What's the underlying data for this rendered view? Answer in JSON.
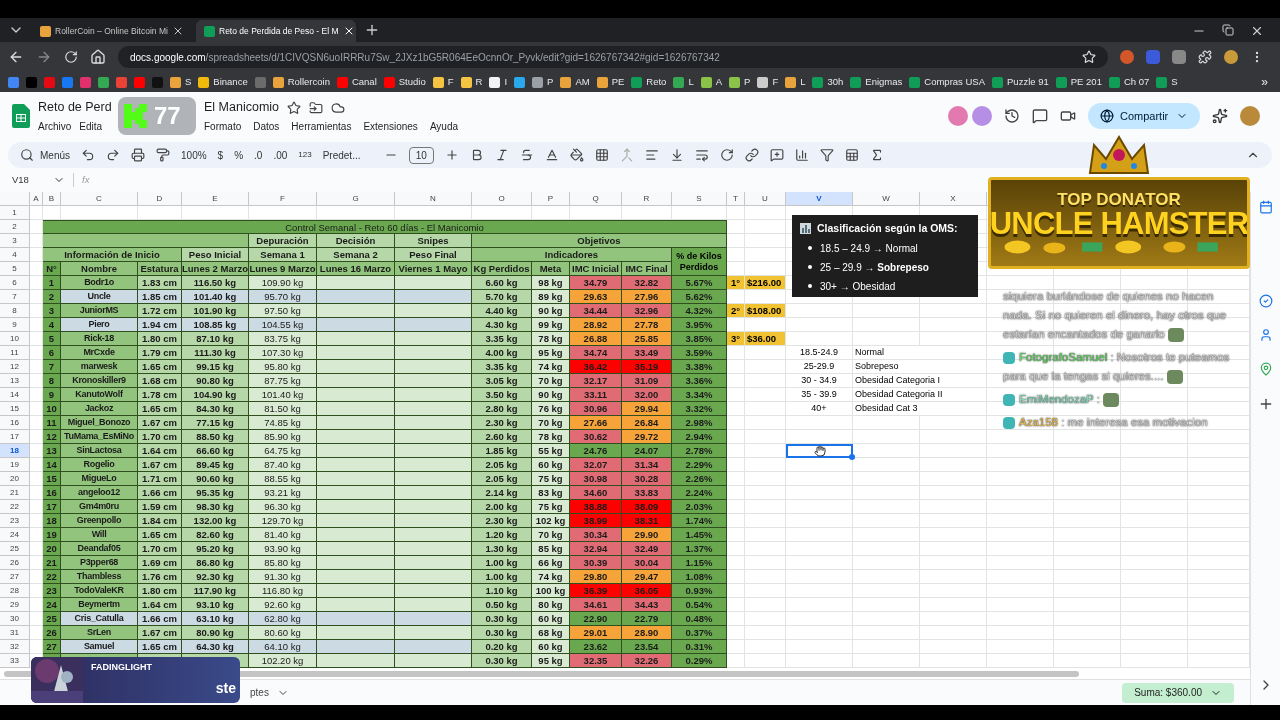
{
  "browser": {
    "tabs": [
      {
        "title": "RollerCoin – Online Bitcoin Mi",
        "selected": false
      },
      {
        "title": "Reto de Perdida de Peso - El M",
        "selected": true
      }
    ],
    "url": {
      "domain": "docs.google.com",
      "path": "/spreadsheets/d/1CIVQSN6uoIRRRu7Sw_2JXz1bG5R064EeOcnnOr_Pyvk/edit?gid=1626767342#gid=1626767342"
    },
    "bookmarks": [
      {
        "color": "#4285f4"
      },
      {
        "color": "#000000"
      },
      {
        "color": "#e50914"
      },
      {
        "color": "#1877f2"
      },
      {
        "color": "#e1306c"
      },
      {
        "color": "#34a853"
      },
      {
        "color": "#ea4335"
      },
      {
        "color": "#ff0000"
      },
      {
        "color": "#111111"
      },
      {
        "label": "S",
        "color": "#e8a33d"
      },
      {
        "label": "Binance",
        "color": "#f0b90b"
      },
      {
        "color": "#6b6b6b"
      },
      {
        "label": "Rollercoin",
        "color": "#e8a33d"
      },
      {
        "label": "Canal",
        "color": "#ff0000"
      },
      {
        "label": "Studio",
        "color": "#ff0000"
      },
      {
        "label": "F",
        "color": "#f5c542"
      },
      {
        "label": "R",
        "color": "#f5c542"
      },
      {
        "label": "I",
        "color": "#f1f3f4"
      },
      {
        "color": "#29a9eb"
      },
      {
        "label": "P",
        "color": "#9aa0a6"
      },
      {
        "label": "AM",
        "color": "#e8a33d"
      },
      {
        "label": "PE",
        "color": "#e8a33d"
      },
      {
        "label": "Reto",
        "color": "#0f9d58"
      },
      {
        "label": "L",
        "color": "#34a853"
      },
      {
        "label": "A",
        "color": "#8bc34a"
      },
      {
        "label": "P",
        "color": "#8bc34a"
      },
      {
        "label": "F",
        "color": "#cccccc"
      },
      {
        "label": "L",
        "color": "#e8a33d"
      },
      {
        "label": "30h",
        "color": "#0f9d58"
      },
      {
        "label": "Enigmas",
        "color": "#0f9d58"
      },
      {
        "label": "Compras USA",
        "color": "#0f9d58"
      },
      {
        "label": "Puzzle 91",
        "color": "#0f9d58"
      },
      {
        "label": "PE 201",
        "color": "#0f9d58"
      },
      {
        "label": "Ch 07",
        "color": "#0f9d58"
      },
      {
        "label": "S",
        "color": "#0f9d58"
      }
    ],
    "bookmarks_more": "»"
  },
  "doc": {
    "title_start": "Reto de Perd",
    "title_end": "El Manicomio",
    "menus_start": [
      "Archivo",
      "Edita"
    ],
    "menus_end": [
      "Formato",
      "Datos",
      "Herramientas",
      "Extensiones",
      "Ayuda"
    ],
    "share": "Compartir"
  },
  "stream_badge": {
    "count": "77"
  },
  "toolbar": {
    "menus": "Menús",
    "zoom": "100%",
    "currency": "$",
    "percent": "%",
    "dec_less": ".0",
    "dec_more": ".00",
    "number_format": "123",
    "font": "Predet...",
    "font_size": "10"
  },
  "formula_bar": {
    "cell": "V18",
    "fx": "fx"
  },
  "column_headers": [
    {
      "label": "A",
      "selected": false
    },
    {
      "label": "B",
      "selected": false
    },
    {
      "label": "C",
      "selected": false
    },
    {
      "label": "D",
      "selected": false
    },
    {
      "label": "E",
      "selected": false
    },
    {
      "label": "F",
      "selected": false
    },
    {
      "label": "G",
      "selected": false
    },
    {
      "label": "N",
      "selected": false
    },
    {
      "label": "O",
      "selected": false
    },
    {
      "label": "P",
      "selected": false
    },
    {
      "label": "Q",
      "selected": false
    },
    {
      "label": "R",
      "selected": false
    },
    {
      "label": "S",
      "selected": false
    },
    {
      "label": "T",
      "selected": false
    },
    {
      "label": "U",
      "selected": false
    },
    {
      "label": "V",
      "selected": true
    },
    {
      "label": "W",
      "selected": false
    },
    {
      "label": "X",
      "selected": false
    }
  ],
  "row_numbers": [
    {
      "label": "1",
      "selected": false
    },
    {
      "label": "2",
      "selected": false
    },
    {
      "label": "3",
      "selected": false
    },
    {
      "label": "4",
      "selected": false
    },
    {
      "label": "5",
      "selected": false
    },
    {
      "label": "6",
      "selected": false
    },
    {
      "label": "7",
      "selected": false
    },
    {
      "label": "8",
      "selected": false
    },
    {
      "label": "9",
      "selected": false
    },
    {
      "label": "10",
      "selected": false
    },
    {
      "label": "11",
      "selected": false
    },
    {
      "label": "12",
      "selected": false
    },
    {
      "label": "13",
      "selected": false
    },
    {
      "label": "14",
      "selected": false
    },
    {
      "label": "15",
      "selected": false
    },
    {
      "label": "16",
      "selected": false
    },
    {
      "label": "17",
      "selected": false
    },
    {
      "label": "18",
      "selected": true
    },
    {
      "label": "19",
      "selected": false
    },
    {
      "label": "20",
      "selected": false
    },
    {
      "label": "21",
      "selected": false
    },
    {
      "label": "22",
      "selected": false
    },
    {
      "label": "23",
      "selected": false
    },
    {
      "label": "24",
      "selected": false
    },
    {
      "label": "25",
      "selected": false
    },
    {
      "label": "26",
      "selected": false
    },
    {
      "label": "27",
      "selected": false
    },
    {
      "label": "28",
      "selected": false
    },
    {
      "label": "29",
      "selected": false
    },
    {
      "label": "30",
      "selected": false
    },
    {
      "label": "31",
      "selected": false
    },
    {
      "label": "32",
      "selected": false
    },
    {
      "label": "33",
      "selected": false
    }
  ],
  "sheet_table": {
    "title": "Control Semanal - Reto 60 días - El Manicomio",
    "group_row": {
      "depuracion": "Depuración",
      "decision": "Decisión",
      "snipes": "Snipes",
      "objetivos": "Objetivos"
    },
    "section_row": {
      "info": "Información de Inicio",
      "peso_inicial": "Peso Inicial",
      "semana1": "Semana 1",
      "semana2": "Semana 2",
      "peso_final": "Peso Final",
      "indicadores": "Indicadores",
      "pct": "% de Kilos Perdidos"
    },
    "columns": [
      "N°",
      "Nombre",
      "Estatura",
      "Lunes 2 Marzo",
      "Lunes 9 Marzo",
      "Lunes 16 Marzo",
      "Viernes 1 Mayo",
      "Kg Perdidos",
      "Meta",
      "IMC Inicial",
      "IMC Final"
    ],
    "rows": [
      {
        "n": "1",
        "name": "Bodr1o",
        "estatura": "1.83 cm",
        "peso_inicial": "116.50 kg",
        "semana1": "109.90 kg",
        "kg": "6.60 kg",
        "meta": "98 kg",
        "imc_inicial": {
          "value": "34.79",
          "color": "#e06b74"
        },
        "imc_final": {
          "value": "32.82",
          "color": "#e06b74"
        },
        "pct": "5.67%",
        "highlighted": false,
        "prize": {
          "place": "1°",
          "amount": "$216.00"
        }
      },
      {
        "n": "2",
        "name": "Uncle",
        "estatura": "1.85 cm",
        "peso_inicial": "101.40 kg",
        "semana1": "95.70 kg",
        "kg": "5.70 kg",
        "meta": "89 kg",
        "imc_inicial": {
          "value": "29.63",
          "color": "#f6a33a"
        },
        "imc_final": {
          "value": "27.96",
          "color": "#f6a33a"
        },
        "pct": "5.62%",
        "highlighted": true
      },
      {
        "n": "3",
        "name": "JuniorMS",
        "estatura": "1.72 cm",
        "peso_inicial": "101.90 kg",
        "semana1": "97.50 kg",
        "kg": "4.40 kg",
        "meta": "90 kg",
        "imc_inicial": {
          "value": "34.44",
          "color": "#e06b74"
        },
        "imc_final": {
          "value": "32.96",
          "color": "#e06b74"
        },
        "pct": "4.32%",
        "highlighted": false,
        "prize": {
          "place": "2°",
          "amount": "$108.00"
        }
      },
      {
        "n": "4",
        "name": "Piero",
        "estatura": "1.94 cm",
        "peso_inicial": "108.85 kg",
        "semana1": "104.55 kg",
        "kg": "4.30 kg",
        "meta": "99 kg",
        "imc_inicial": {
          "value": "28.92",
          "color": "#f6a33a"
        },
        "imc_final": {
          "value": "27.78",
          "color": "#f6a33a"
        },
        "pct": "3.95%",
        "highlighted": true
      },
      {
        "n": "5",
        "name": "Rick-18",
        "estatura": "1.80 cm",
        "peso_inicial": "87.10 kg",
        "semana1": "83.75 kg",
        "kg": "3.35 kg",
        "meta": "78 kg",
        "imc_inicial": {
          "value": "26.88",
          "color": "#f6a33a"
        },
        "imc_final": {
          "value": "25.85",
          "color": "#f6a33a"
        },
        "pct": "3.85%",
        "highlighted": false,
        "prize": {
          "place": "3°",
          "amount": "$36.00"
        }
      },
      {
        "n": "6",
        "name": "MrCxde",
        "estatura": "1.79 cm",
        "peso_inicial": "111.30 kg",
        "semana1": "107.30 kg",
        "kg": "4.00 kg",
        "meta": "95 kg",
        "imc_inicial": {
          "value": "34.74",
          "color": "#e06b74"
        },
        "imc_final": {
          "value": "33.49",
          "color": "#e06b74"
        },
        "pct": "3.59%",
        "highlighted": false
      },
      {
        "n": "7",
        "name": "marwesk",
        "estatura": "1.65 cm",
        "peso_inicial": "99.15 kg",
        "semana1": "95.80 kg",
        "kg": "3.35 kg",
        "meta": "74 kg",
        "imc_inicial": {
          "value": "36.42",
          "color": "#ff0000"
        },
        "imc_final": {
          "value": "35.19",
          "color": "#ff0000"
        },
        "pct": "3.38%",
        "highlighted": false
      },
      {
        "n": "8",
        "name": "Kronoskiller9",
        "estatura": "1.68 cm",
        "peso_inicial": "90.80 kg",
        "semana1": "87.75 kg",
        "kg": "3.05 kg",
        "meta": "70 kg",
        "imc_inicial": {
          "value": "32.17",
          "color": "#e06b74"
        },
        "imc_final": {
          "value": "31.09",
          "color": "#e06b74"
        },
        "pct": "3.36%",
        "highlighted": false
      },
      {
        "n": "9",
        "name": "KanutoWolf",
        "estatura": "1.78 cm",
        "peso_inicial": "104.90 kg",
        "semana1": "101.40 kg",
        "kg": "3.50 kg",
        "meta": "90 kg",
        "imc_inicial": {
          "value": "33.11",
          "color": "#e06b74"
        },
        "imc_final": {
          "value": "32.00",
          "color": "#e06b74"
        },
        "pct": "3.34%",
        "highlighted": false
      },
      {
        "n": "10",
        "name": "Jackoz",
        "estatura": "1.65 cm",
        "peso_inicial": "84.30 kg",
        "semana1": "81.50 kg",
        "kg": "2.80 kg",
        "meta": "76 kg",
        "imc_inicial": {
          "value": "30.96",
          "color": "#e06b74"
        },
        "imc_final": {
          "value": "29.94",
          "color": "#f6a33a"
        },
        "pct": "3.32%",
        "highlighted": false
      },
      {
        "n": "11",
        "name": "Miguel_Bonozo",
        "estatura": "1.67 cm",
        "peso_inicial": "77.15 kg",
        "semana1": "74.85 kg",
        "kg": "2.30 kg",
        "meta": "70 kg",
        "imc_inicial": {
          "value": "27.66",
          "color": "#f6a33a"
        },
        "imc_final": {
          "value": "26.84",
          "color": "#f6a33a"
        },
        "pct": "2.98%",
        "highlighted": false
      },
      {
        "n": "12",
        "name": "TuMama_EsMiNo",
        "estatura": "1.70 cm",
        "peso_inicial": "88.50 kg",
        "semana1": "85.90 kg",
        "kg": "2.60 kg",
        "meta": "78 kg",
        "imc_inicial": {
          "value": "30.62",
          "color": "#e06b74"
        },
        "imc_final": {
          "value": "29.72",
          "color": "#f6a33a"
        },
        "pct": "2.94%",
        "highlighted": false
      },
      {
        "n": "13",
        "name": "SinLactosa",
        "estatura": "1.64 cm",
        "peso_inicial": "66.60 kg",
        "semana1": "64.75 kg",
        "kg": "1.85 kg",
        "meta": "55 kg",
        "imc_inicial": {
          "value": "24.76",
          "color": "#6aa84f"
        },
        "imc_final": {
          "value": "24.07",
          "color": "#6aa84f"
        },
        "pct": "2.78%",
        "highlighted": false
      },
      {
        "n": "14",
        "name": "Rogelio",
        "estatura": "1.67 cm",
        "peso_inicial": "89.45 kg",
        "semana1": "87.40 kg",
        "kg": "2.05 kg",
        "meta": "60 kg",
        "imc_inicial": {
          "value": "32.07",
          "color": "#e06b74"
        },
        "imc_final": {
          "value": "31.34",
          "color": "#e06b74"
        },
        "pct": "2.29%",
        "highlighted": false
      },
      {
        "n": "15",
        "name": "MigueLo",
        "estatura": "1.71 cm",
        "peso_inicial": "90.60 kg",
        "semana1": "88.55 kg",
        "kg": "2.05 kg",
        "meta": "75 kg",
        "imc_inicial": {
          "value": "30.98",
          "color": "#e06b74"
        },
        "imc_final": {
          "value": "30.28",
          "color": "#e06b74"
        },
        "pct": "2.26%",
        "highlighted": false
      },
      {
        "n": "16",
        "name": "angeloo12",
        "estatura": "1.66 cm",
        "peso_inicial": "95.35 kg",
        "semana1": "93.21 kg",
        "kg": "2.14 kg",
        "meta": "83 kg",
        "imc_inicial": {
          "value": "34.60",
          "color": "#e06b74"
        },
        "imc_final": {
          "value": "33.83",
          "color": "#e06b74"
        },
        "pct": "2.24%",
        "highlighted": false
      },
      {
        "n": "17",
        "name": "Gm4m0ru",
        "estatura": "1.59 cm",
        "peso_inicial": "98.30 kg",
        "semana1": "96.30 kg",
        "kg": "2.00 kg",
        "meta": "75 kg",
        "imc_inicial": {
          "value": "38.88",
          "color": "#ff0000"
        },
        "imc_final": {
          "value": "38.09",
          "color": "#ff0000"
        },
        "pct": "2.03%",
        "highlighted": false
      },
      {
        "n": "18",
        "name": "Greenpollo",
        "estatura": "1.84 cm",
        "peso_inicial": "132.00 kg",
        "semana1": "129.70 kg",
        "kg": "2.30 kg",
        "meta": "102 kg",
        "imc_inicial": {
          "value": "38.99",
          "color": "#ff0000"
        },
        "imc_final": {
          "value": "38.31",
          "color": "#ff0000"
        },
        "pct": "1.74%",
        "highlighted": false
      },
      {
        "n": "19",
        "name": "Will",
        "estatura": "1.65 cm",
        "peso_inicial": "82.60 kg",
        "semana1": "81.40 kg",
        "kg": "1.20 kg",
        "meta": "70 kg",
        "imc_inicial": {
          "value": "30.34",
          "color": "#e06b74"
        },
        "imc_final": {
          "value": "29.90",
          "color": "#f6a33a"
        },
        "pct": "1.45%",
        "highlighted": false
      },
      {
        "n": "20",
        "name": "Deandaf05",
        "estatura": "1.70 cm",
        "peso_inicial": "95.20 kg",
        "semana1": "93.90 kg",
        "kg": "1.30 kg",
        "meta": "85 kg",
        "imc_inicial": {
          "value": "32.94",
          "color": "#e06b74"
        },
        "imc_final": {
          "value": "32.49",
          "color": "#e06b74"
        },
        "pct": "1.37%",
        "highlighted": false
      },
      {
        "n": "21",
        "name": "P3pper68",
        "estatura": "1.69 cm",
        "peso_inicial": "86.80 kg",
        "semana1": "85.80 kg",
        "kg": "1.00 kg",
        "meta": "66 kg",
        "imc_inicial": {
          "value": "30.39",
          "color": "#e06b74"
        },
        "imc_final": {
          "value": "30.04",
          "color": "#e06b74"
        },
        "pct": "1.15%",
        "highlighted": false
      },
      {
        "n": "22",
        "name": "Thambless",
        "estatura": "1.76 cm",
        "peso_inicial": "92.30 kg",
        "semana1": "91.30 kg",
        "kg": "1.00 kg",
        "meta": "74 kg",
        "imc_inicial": {
          "value": "29.80",
          "color": "#f6a33a"
        },
        "imc_final": {
          "value": "29.47",
          "color": "#f6a33a"
        },
        "pct": "1.08%",
        "highlighted": false
      },
      {
        "n": "23",
        "name": "TodoValeKR",
        "estatura": "1.80 cm",
        "peso_inicial": "117.90 kg",
        "semana1": "116.80 kg",
        "kg": "1.10 kg",
        "meta": "100 kg",
        "imc_inicial": {
          "value": "36.39",
          "color": "#ff0000"
        },
        "imc_final": {
          "value": "36.05",
          "color": "#ff0000"
        },
        "pct": "0.93%",
        "highlighted": false
      },
      {
        "n": "24",
        "name": "Beymertm",
        "estatura": "1.64 cm",
        "peso_inicial": "93.10 kg",
        "semana1": "92.60 kg",
        "kg": "0.50 kg",
        "meta": "80 kg",
        "imc_inicial": {
          "value": "34.61",
          "color": "#e06b74"
        },
        "imc_final": {
          "value": "34.43",
          "color": "#e06b74"
        },
        "pct": "0.54%",
        "highlighted": false
      },
      {
        "n": "25",
        "name": "Cris_Catulla",
        "estatura": "1.66 cm",
        "peso_inicial": "63.10 kg",
        "semana1": "62.80 kg",
        "kg": "0.30 kg",
        "meta": "60 kg",
        "imc_inicial": {
          "value": "22.90",
          "color": "#6aa84f"
        },
        "imc_final": {
          "value": "22.79",
          "color": "#6aa84f"
        },
        "pct": "0.48%",
        "highlighted": true
      },
      {
        "n": "26",
        "name": "SrLen",
        "estatura": "1.67 cm",
        "peso_inicial": "80.90 kg",
        "semana1": "80.60 kg",
        "kg": "0.30 kg",
        "meta": "68 kg",
        "imc_inicial": {
          "value": "29.01",
          "color": "#f6a33a"
        },
        "imc_final": {
          "value": "28.90",
          "color": "#f6a33a"
        },
        "pct": "0.37%",
        "highlighted": false
      },
      {
        "n": "27",
        "name": "Samuel",
        "estatura": "1.65 cm",
        "peso_inicial": "64.30 kg",
        "semana1": "64.10 kg",
        "kg": "0.20 kg",
        "meta": "60 kg",
        "imc_inicial": {
          "value": "23.62",
          "color": "#6aa84f"
        },
        "imc_final": {
          "value": "23.54",
          "color": "#6aa84f"
        },
        "pct": "0.31%",
        "highlighted": true
      },
      {
        "semana1": "102.20 kg",
        "kg": "0.30 kg",
        "meta": "95 kg",
        "imc_inicial": {
          "value": "32.35",
          "color": "#e06b74"
        },
        "imc_final": {
          "value": "32.26",
          "color": "#e06b74"
        },
        "pct": "0.29%",
        "highlighted": false
      }
    ]
  },
  "imc_table": [
    {
      "range": "18.5-24.9",
      "label": "Normal"
    },
    {
      "range": "25-29.9",
      "label": "Sobrepeso"
    },
    {
      "range": "30 - 34.9",
      "label": "Obesidad Categoria I"
    },
    {
      "range": "35 - 39.9",
      "label": "Obesidad Categoria II"
    },
    {
      "range": "40+",
      "label": "Obesidad Cat 3"
    }
  ],
  "oms_tooltip": {
    "title": "Clasificación según la OMS:",
    "items": [
      "18.5 – 24.9 → Normal",
      "25 – 29.9 → **Sobrepeso**",
      "30+ → Obesidad"
    ]
  },
  "donator_banner": {
    "heading": "TOP DONATOR",
    "name": "UNCLE HAMSTER"
  },
  "chat": [
    {
      "text": "siquiera burlándose de quienes no hacen nada. Si no quieren el dinero, hay otros que estarían encantados de ganarlo",
      "emote": true
    },
    {
      "user": "FotografoSamuel",
      "color": "#5fd35f",
      "text": ": Nosotros te puteamos para que la tengas si quieres....",
      "emote": true
    },
    {
      "user": "EmiMendozaP",
      "color": "#7fd6b4",
      "text": ":",
      "emote": true
    },
    {
      "user": "Aza158",
      "color": "#e6b84a",
      "text": ": me interesa esa motivacion",
      "emote": false
    }
  ],
  "alert_card": {
    "name": "FADINGLIGHT",
    "text": "ste"
  },
  "sheet_tab": {
    "label": "ptes"
  },
  "status": {
    "sum": "Suma: $360.00"
  }
}
